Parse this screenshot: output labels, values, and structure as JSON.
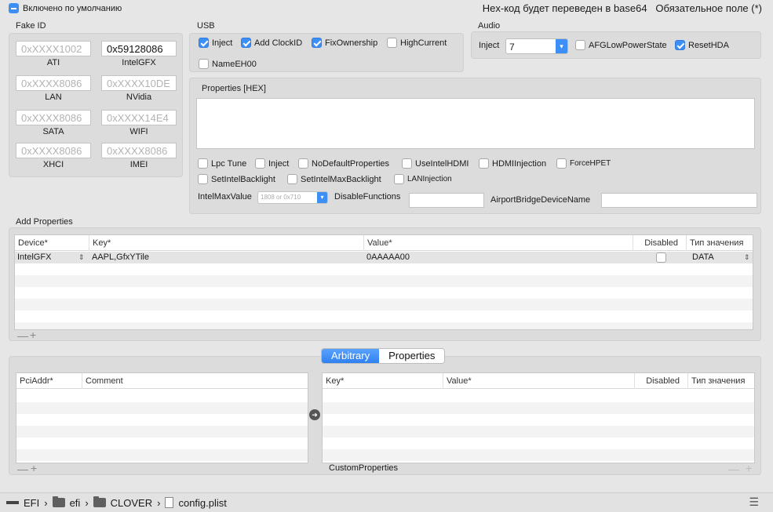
{
  "header": {
    "default_label": "Включено по умолчанию",
    "notice": "Hex-код будет переведен в base64   Обязательное поле (*)"
  },
  "fake_id": {
    "title": "Fake ID",
    "fields": [
      {
        "value": "",
        "placeholder": "0xXXXX1002",
        "label": "ATI"
      },
      {
        "value": "0x59128086",
        "placeholder": "",
        "label": "IntelGFX"
      },
      {
        "value": "",
        "placeholder": "0xXXXX8086",
        "label": "LAN"
      },
      {
        "value": "",
        "placeholder": "0xXXXX10DE",
        "label": "NVidia"
      },
      {
        "value": "",
        "placeholder": "0xXXXX8086",
        "label": "SATA"
      },
      {
        "value": "",
        "placeholder": "0xXXXX14E4",
        "label": "WIFI"
      },
      {
        "value": "",
        "placeholder": "0xXXXX8086",
        "label": "XHCI"
      },
      {
        "value": "",
        "placeholder": "0xXXXX8086",
        "label": "IMEI"
      }
    ]
  },
  "usb": {
    "title": "USB",
    "options": [
      {
        "label": "Inject",
        "checked": true
      },
      {
        "label": "Add ClockID",
        "checked": true
      },
      {
        "label": "FixOwnership",
        "checked": true
      },
      {
        "label": "HighCurrent",
        "checked": false
      },
      {
        "label": "NameEH00",
        "checked": false
      }
    ]
  },
  "audio": {
    "title": "Audio",
    "inject_label": "Inject",
    "inject_value": "7",
    "options": [
      {
        "label": "AFGLowPowerState",
        "checked": false
      },
      {
        "label": "ResetHDA",
        "checked": true
      }
    ]
  },
  "properties": {
    "title": "Properties [HEX]",
    "options": [
      {
        "label": "Lpc Tune",
        "checked": false
      },
      {
        "label": "Inject",
        "checked": false
      },
      {
        "label": "NoDefaultProperties",
        "checked": false
      },
      {
        "label": "UseIntelHDMI",
        "checked": false
      },
      {
        "label": "HDMIInjection",
        "checked": false
      },
      {
        "label": "ForceHPET",
        "checked": false
      },
      {
        "label": "SetIntelBacklight",
        "checked": false
      },
      {
        "label": "SetIntelMaxBacklight",
        "checked": false
      },
      {
        "label": "LANInjection",
        "checked": false
      }
    ],
    "intel_max_label": "IntelMaxValue",
    "intel_max_placeholder": "1808 or 0x710",
    "disable_functions_label": "DisableFunctions",
    "airport_label": "AirportBridgeDeviceName"
  },
  "add_properties": {
    "title": "Add Properties",
    "columns": [
      "Device*",
      "Key*",
      "Value*",
      "Disabled",
      "Тип значения"
    ],
    "rows": [
      {
        "device": "IntelGFX",
        "key": "AAPL,GfxYTile",
        "value": "0AAAAA00",
        "disabled": false,
        "type": "DATA"
      }
    ]
  },
  "segmented": {
    "tabs": [
      "Arbitrary",
      "Properties"
    ]
  },
  "arbitrary": {
    "columns": [
      "PciAddr*",
      "Comment"
    ],
    "custom_columns": [
      "Key*",
      "Value*",
      "Disabled",
      "Тип значения"
    ],
    "custom_label": "CustomProperties"
  },
  "footer": {
    "path": [
      "EFI",
      "efi",
      "CLOVER",
      "config.plist"
    ]
  },
  "colors": {
    "accent": "#3d8ff5"
  }
}
